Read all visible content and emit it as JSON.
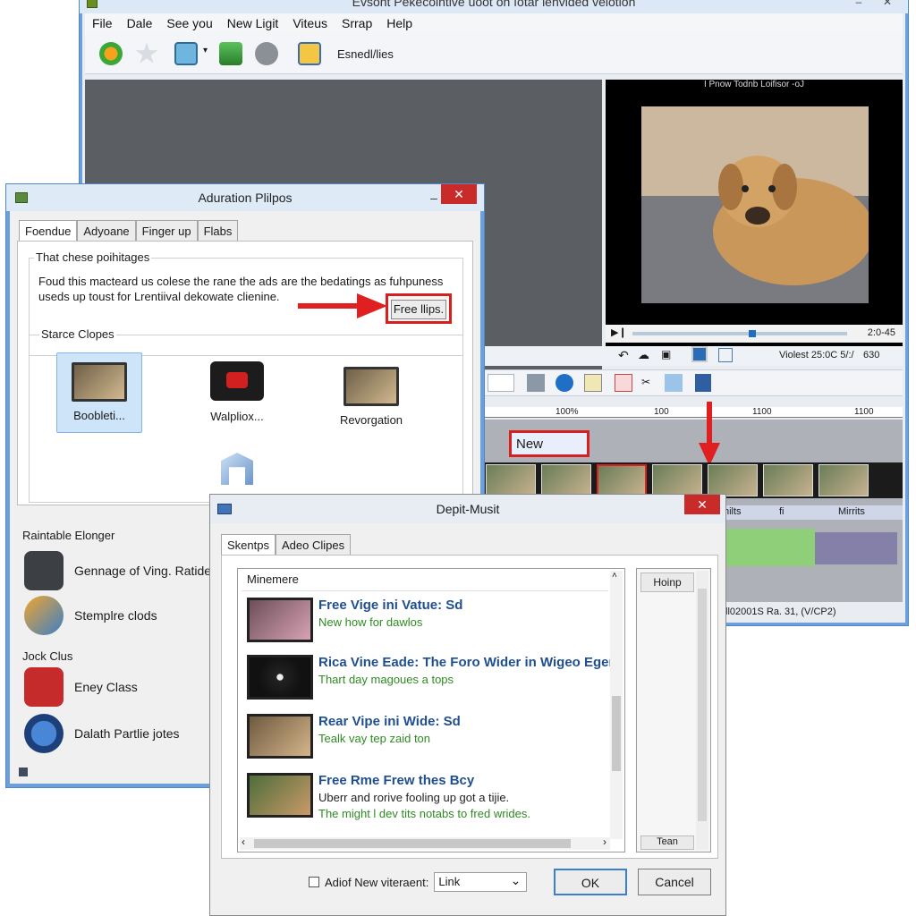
{
  "main_window": {
    "title": "Evsont Pekecointive uoot on ıotar lenvided velotion",
    "menu": [
      "File",
      "Dale",
      "See you",
      "New Ligit",
      "Viteus",
      "Srrap",
      "Help"
    ],
    "toolbar_text": "Esnedl/lies",
    "preview_title": "I Pnow Todnb Loifisor -oJ",
    "player_time": "2:0-45",
    "status_text": "Violest 25:0C 5/:/",
    "status_value": "630",
    "timeline_new_label": "New",
    "ruler_marks": [
      "100%",
      "100",
      "1100",
      "1100"
    ],
    "track_labels": [
      "hilts",
      "fi",
      "Mirrits"
    ],
    "bottom_status": "ll02001S Ra. 31, (V/CP2)"
  },
  "settings_dialog": {
    "title": "Aduration Plilpos",
    "tabs": [
      "Foendue",
      "Adyoane",
      "Finger up",
      "Flabs"
    ],
    "group_label": "That chese poihitages",
    "description": "Foud this macteard us colese the rane the ads are the bedatings as fuhpuness useds up toust for Lrentiival dekowate clienine.",
    "highlight_button": "Free llips.",
    "source_clips_label": "Starce Clopes",
    "clips": [
      {
        "label": "Boobleti...",
        "selected": true
      },
      {
        "label": "Walpliox...",
        "selected": false
      },
      {
        "label": "Revorgation",
        "selected": false
      }
    ],
    "section_1_label": "Raintable Elonger",
    "section_1_items": [
      "Gennage of Ving. Ratide fe",
      "Stemplre clods"
    ],
    "section_2_label": "Jock Clus",
    "section_2_items": [
      "Eney Class",
      "Dalath Partlie jotes"
    ]
  },
  "import_dialog": {
    "title": "Depit-Musit",
    "tabs": [
      "Skentps",
      "Adeo Clipes"
    ],
    "list_header": "Minemere",
    "items": [
      {
        "title": "Free Vige ini Vatue: Sd",
        "line1": "New how for dawlos",
        "line2": ""
      },
      {
        "title": "Rica Vine Eade: The Foro Wider in Wigeo Eger",
        "line1": "Thart day magoues a tops",
        "line2": ""
      },
      {
        "title": "Rear Vipe ini Wide: Sd",
        "line1": "Tealk vay tep zaid ton",
        "line2": ""
      },
      {
        "title": "Free Rme Frew thes Bcy",
        "line1": "Uberr and rorive fooling up got a tijie.",
        "line2": "The might l dev tits notabs to fred wrides."
      }
    ],
    "side_header": "Hoinp",
    "side_footer": "Tean",
    "checkbox_label": "Adiof New viteraent:",
    "select_value": "Link",
    "ok_label": "OK",
    "cancel_label": "Cancel"
  },
  "colors": {
    "accent": "#6ca0dc",
    "close": "#c92a2a",
    "highlight": "#d62020",
    "title_link": "#1f4f8f",
    "subtitle_green": "#2e8b22"
  }
}
